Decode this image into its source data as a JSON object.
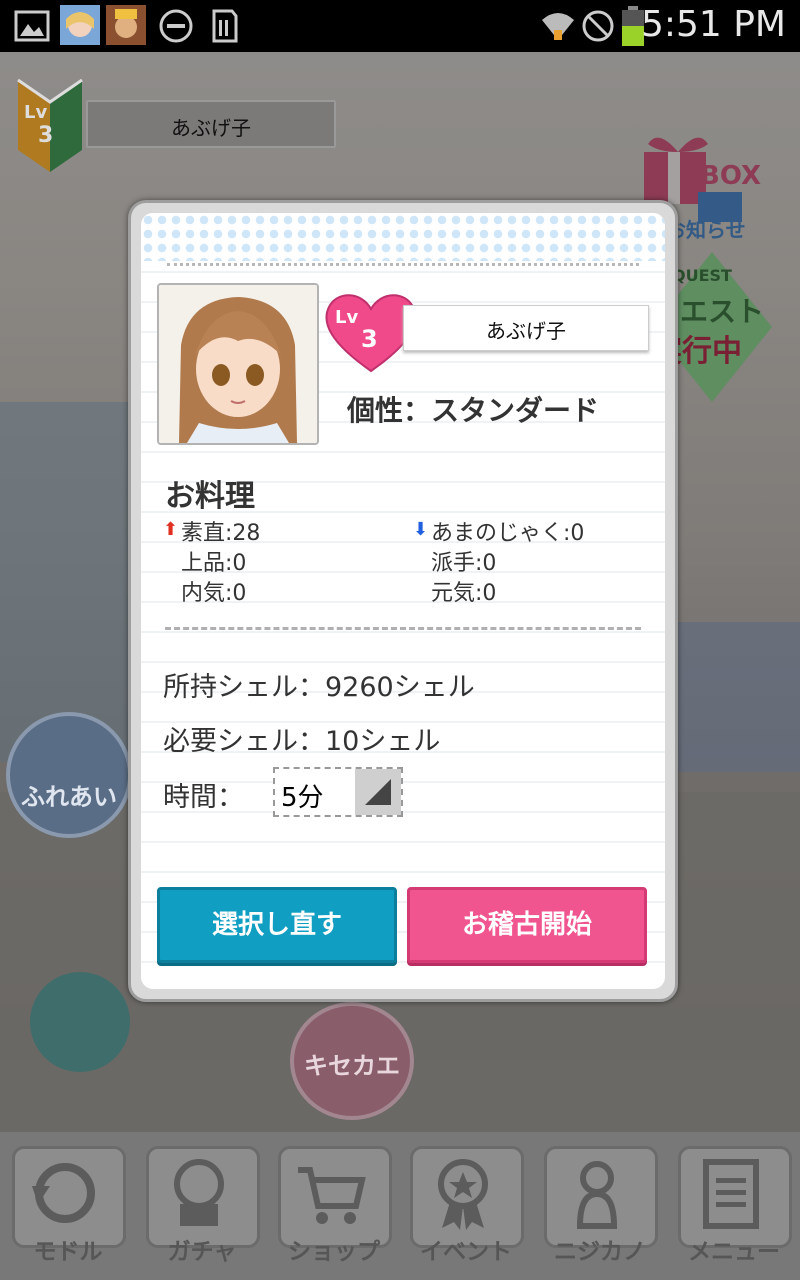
{
  "status_bar": {
    "time": "5:51 PM",
    "icons": [
      "image-icon",
      "app-avatar-icon",
      "app-avatar2-icon",
      "do-not-disturb-icon",
      "sd-card-icon",
      "wifi-icon",
      "blocked-icon",
      "battery-icon"
    ]
  },
  "hud": {
    "level": "3",
    "level_prefix": "Lv",
    "player_name": "あぶげ子",
    "box_label": "BOX",
    "notice_label": "お知らせ",
    "quest_label": "QUEST",
    "quest_sub1": "クエスト",
    "quest_sub2": "実行中",
    "fureai_label": "ふれあい",
    "kisekae_label": "キセカエ"
  },
  "modal": {
    "level": "3",
    "level_prefix": "Lv",
    "name": "あぶげ子",
    "personality": "個性：スタンダード",
    "section_title": "お料理",
    "stats_left": [
      "素直:28",
      "上品:0",
      "内気:0"
    ],
    "stats_right": [
      "あまのじゃく:0",
      "派手:0",
      "元気:0"
    ],
    "owned_shells": "所持シェル：9260シェル",
    "required_shells": "必要シェル：10シェル",
    "time_label": "時間：",
    "time_value": "5分",
    "reselect_button": "選択し直す",
    "start_button": "お稽古開始"
  },
  "bottom_nav": [
    {
      "label": "モドル",
      "icon": "back-icon"
    },
    {
      "label": "ガチャ",
      "icon": "gacha-icon"
    },
    {
      "label": "ショップ",
      "icon": "shop-cart-icon"
    },
    {
      "label": "イベント",
      "icon": "event-ribbon-icon"
    },
    {
      "label": "ニジカノ",
      "icon": "nijikano-icon"
    },
    {
      "label": "メニュー",
      "icon": "menu-icon"
    }
  ],
  "colors": {
    "reselect": "#109ec2",
    "start": "#f0558f",
    "heart": "#f04a8a",
    "stat_up_arrow": "#e03020",
    "stat_down_arrow": "#2060e0"
  }
}
